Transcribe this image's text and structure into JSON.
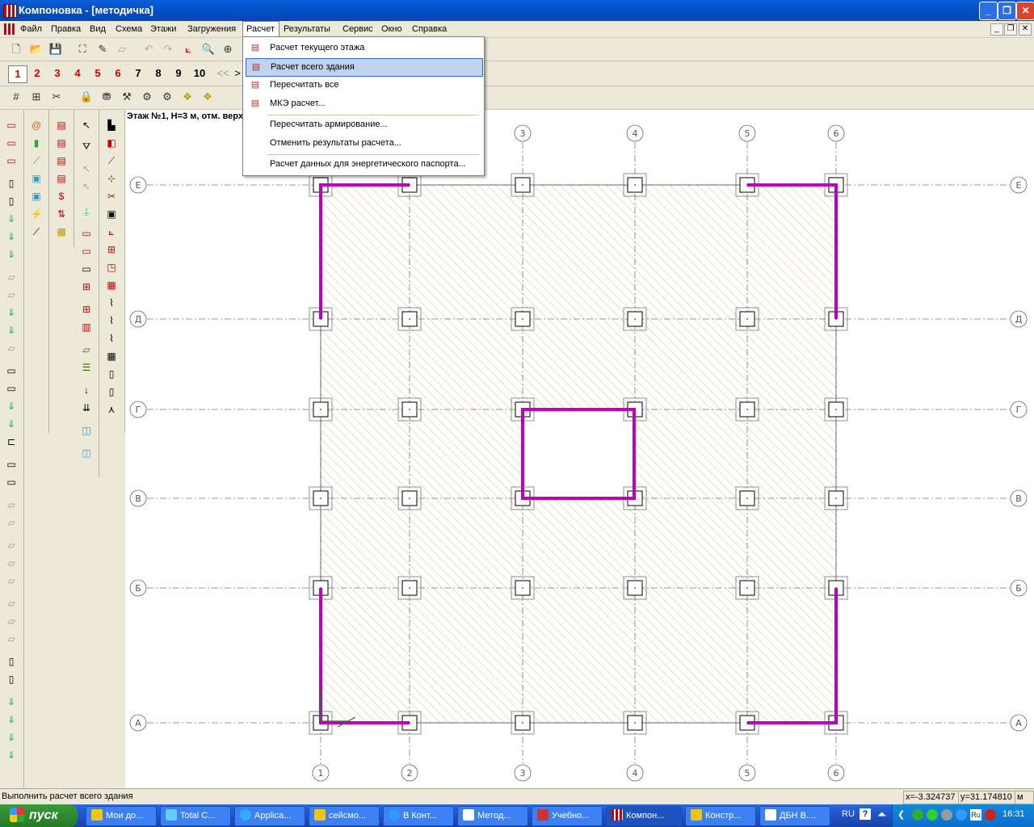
{
  "window": {
    "title": "Компоновка - [методичка]"
  },
  "menu": [
    "Файл",
    "Правка",
    "Вид",
    "Схема",
    "Этажи",
    "Загружения",
    "Расчет",
    "Результаты",
    "Сервис",
    "Окно",
    "Справка"
  ],
  "floor_buttons": [
    "1",
    "2",
    "3",
    "4",
    "5",
    "6",
    "7",
    "8",
    "9",
    "10"
  ],
  "floor_nav": "<<",
  "floor_nav2": ">",
  "floor_label": "Этаж №1, H=3 м, отм. верх",
  "dropdown": {
    "items": [
      "Расчет текущего этажа",
      "Расчет всего здания",
      "Пересчитать все",
      "МКЭ расчет...",
      "Пересчитать армирование...",
      "Отменить результаты расчета...",
      "Расчет данных для энергетического паспорта..."
    ]
  },
  "axes": {
    "columns": [
      "1",
      "2",
      "3",
      "4",
      "5",
      "6"
    ],
    "rows": [
      "Е",
      "Д",
      "Г",
      "В",
      "Б",
      "А"
    ]
  },
  "status": {
    "message": "Выполнить расчет всего здания",
    "x": "x=-3.324737",
    "y": "y=31.174810",
    "unit": "м"
  },
  "taskbar": {
    "start": "пуск",
    "tasks": [
      "Мои до...",
      "Total C...",
      "Applica...",
      "сейсмо...",
      "В Конт...",
      "Метод...",
      "Учебно...",
      "Компон...",
      "Констр...",
      "ДБН В...."
    ],
    "lang": "RU",
    "time": "16:31"
  },
  "colors": {
    "wall": "#c000c0",
    "hatch": "#d8c89a",
    "selection": "#c1d2ee"
  }
}
